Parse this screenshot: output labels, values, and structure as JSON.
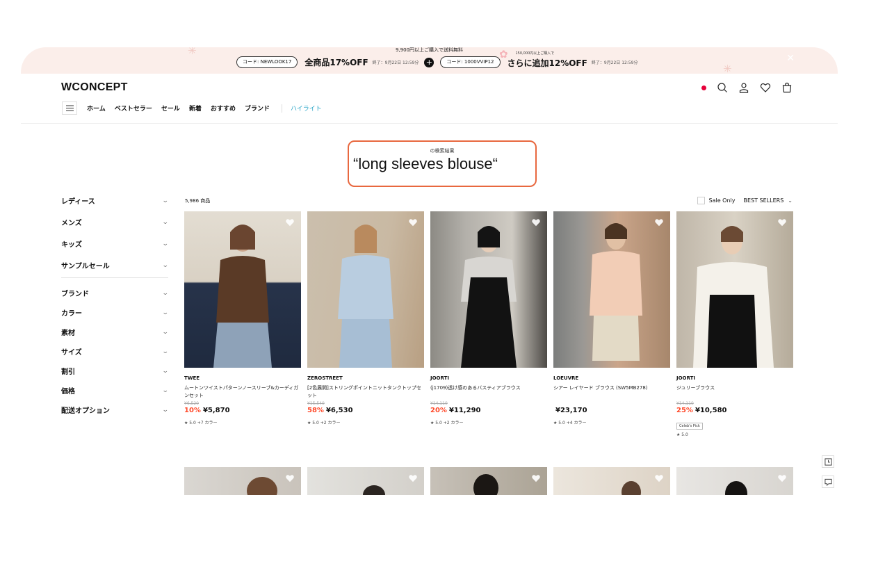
{
  "promo": {
    "top_text": "9,900円以上ご購入で送料無料",
    "code1": "コード: NEWLOOK17",
    "deal1": "全商品17%OFF",
    "end1": "終了：9月22日 12:59分",
    "code2": "コード: 1000VVIP12",
    "deal2_small": "150,000円以上ご購入で",
    "deal2": "さらに追加12%OFF",
    "end2": "終了：9月22日 12:59分"
  },
  "header": {
    "logo": "WCONCEPT",
    "nav": [
      "ホーム",
      "ベストセラー",
      "セール",
      "新着",
      "おすすめ",
      "ブランド"
    ],
    "nav_highlight": "ハイライト"
  },
  "search": {
    "label": "の検索結果",
    "query": "“long sleeves blouse“"
  },
  "sidebar": {
    "group1": [
      "レディース",
      "メンズ",
      "キッズ",
      "サンプルセール"
    ],
    "group2": [
      "ブランド",
      "カラー",
      "素材",
      "サイズ",
      "割引",
      "価格",
      "配送オプション"
    ]
  },
  "listing": {
    "count": "5,986 商品",
    "sale_only": "Sale Only",
    "sort": "BEST SELLERS"
  },
  "products": [
    {
      "brand": "TWEE",
      "title": "ムートンツイストパターンノースリーブ&カーディガンセット",
      "orig": "¥6,520",
      "discount": "10%",
      "price": "¥5,870",
      "meta": "★ 5.0  +7 カラー",
      "badge": ""
    },
    {
      "brand": "ZEROSTREET",
      "title": "[2色展開]ストリングポイントニットタンクトップセット",
      "orig": "¥15,540",
      "discount": "58%",
      "price": "¥6,530",
      "meta": "★ 5.0  +2 カラー",
      "badge": ""
    },
    {
      "brand": "JOORTI",
      "title": "(j1709)透け感のあるバスティアブラウス",
      "orig": "¥14,110",
      "discount": "20%",
      "price": "¥11,290",
      "meta": "★ 5.0  +2 カラー",
      "badge": ""
    },
    {
      "brand": "LOEUVRE",
      "title": "シアー レイヤード ブラウス (SW5MB278)",
      "orig": "",
      "discount": "",
      "price": "¥23,170",
      "meta": "★ 5.0  +4 カラー",
      "badge": ""
    },
    {
      "brand": "JOORTI",
      "title": "ジュリーブラウス",
      "orig": "¥14,110",
      "discount": "25%",
      "price": "¥10,580",
      "meta": "★ 5.0",
      "badge": "Celeb's Pick"
    }
  ],
  "colors": {
    "accent": "#ff4a2b",
    "highlight": "#2aa6c7",
    "box": "#e8683f",
    "banner": "#fbeeea"
  }
}
